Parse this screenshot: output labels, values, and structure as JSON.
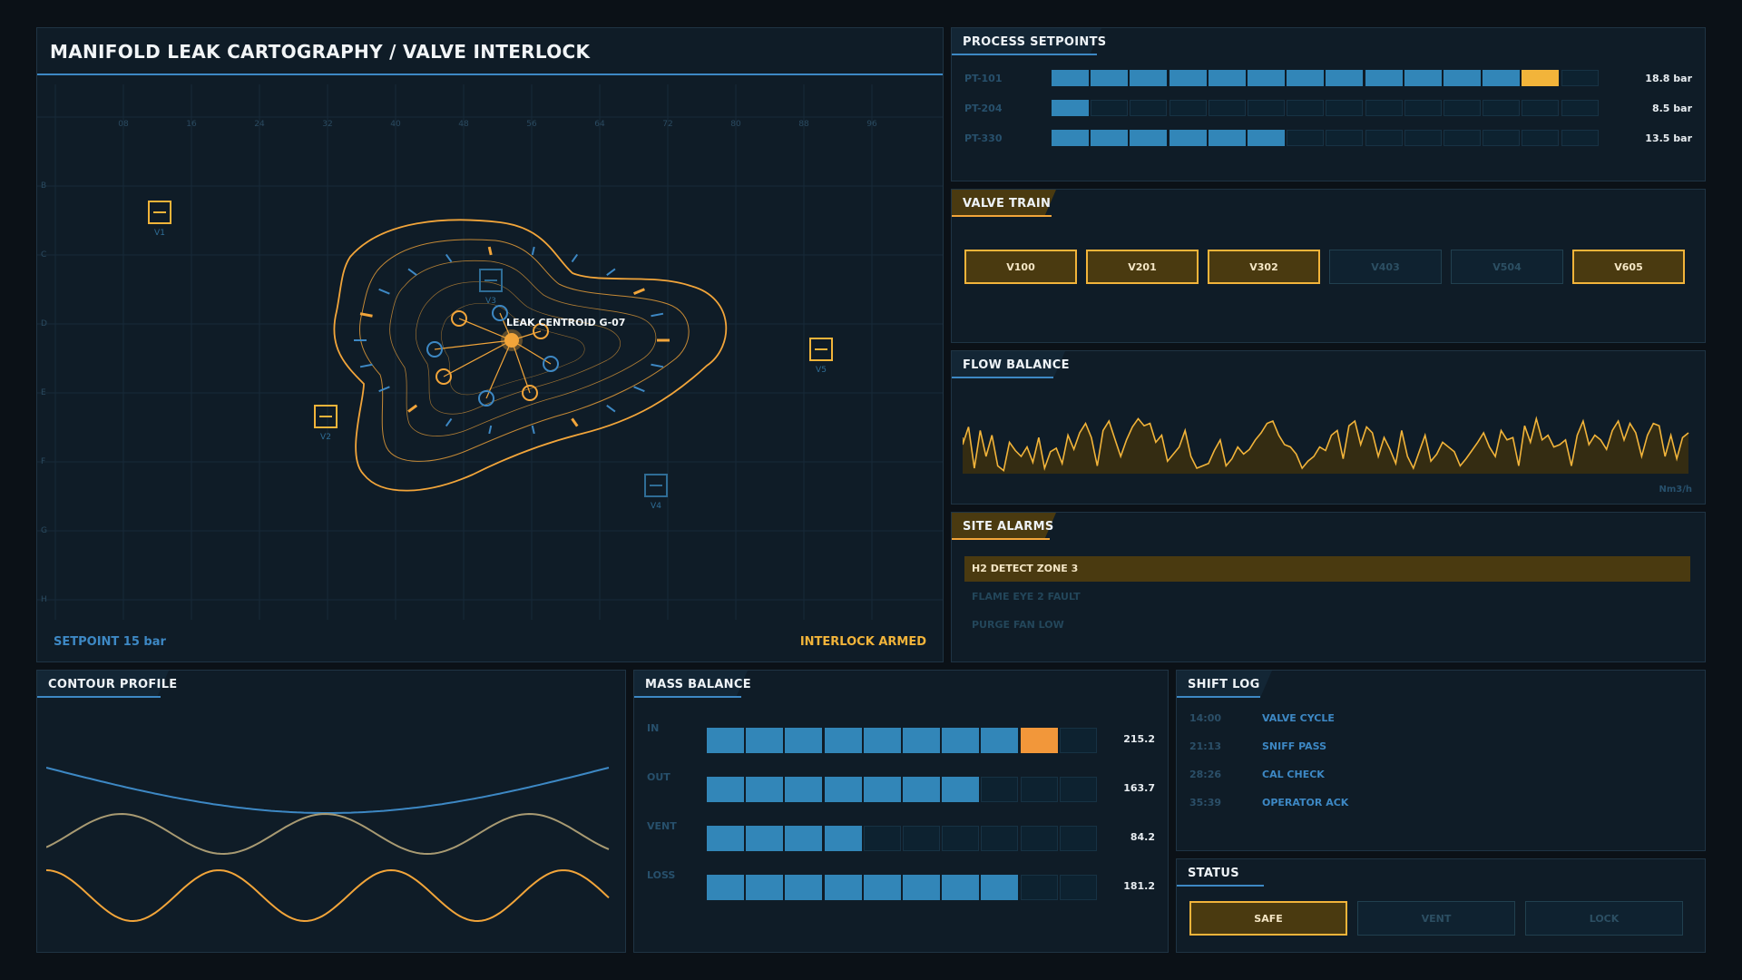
{
  "map": {
    "title": "MANIFOLD LEAK CARTOGRAPHY / VALVE INTERLOCK",
    "x_ticks": [
      "08",
      "16",
      "24",
      "32",
      "40",
      "48",
      "56",
      "64",
      "72",
      "80",
      "88",
      "96"
    ],
    "y_ticks": [
      "B",
      "C",
      "D",
      "E",
      "F",
      "G",
      "H"
    ],
    "valves": [
      "V1",
      "V2",
      "V3",
      "V4",
      "V5"
    ],
    "centroid_label": "LEAK CENTROID  G-07",
    "setpoint_text": "SETPOINT 15 bar",
    "interlock_text": "INTERLOCK ARMED"
  },
  "setpoints": {
    "title": "PROCESS SETPOINTS",
    "rows": [
      {
        "label": "PT-101",
        "value": "18.8 bar",
        "fill": 13,
        "accent": true
      },
      {
        "label": "PT-204",
        "value": "8.5 bar",
        "fill": 1,
        "accent": false
      },
      {
        "label": "PT-330",
        "value": "13.5 bar",
        "fill": 6,
        "accent": false
      }
    ],
    "segments": 14
  },
  "valve_train": {
    "title": "VALVE TRAIN",
    "valves": [
      {
        "label": "V100",
        "active": true
      },
      {
        "label": "V201",
        "active": true
      },
      {
        "label": "V302",
        "active": true
      },
      {
        "label": "V403",
        "active": false
      },
      {
        "label": "V504",
        "active": false
      },
      {
        "label": "V605",
        "active": true
      }
    ]
  },
  "flow": {
    "title": "FLOW BALANCE",
    "unit": "Nm3/h",
    "values": [
      40,
      55,
      20,
      52,
      30,
      48,
      22,
      18,
      42,
      35,
      30,
      38,
      25,
      46,
      20,
      34,
      37,
      24,
      48,
      36,
      50,
      58,
      46,
      22,
      52,
      60,
      45,
      30,
      44,
      55,
      62,
      56,
      58,
      42,
      48,
      26,
      32,
      38,
      52,
      30,
      20,
      22,
      24,
      35,
      44,
      22,
      28,
      38,
      32,
      36,
      44,
      50,
      58,
      60,
      48,
      40,
      38,
      32,
      20,
      26,
      30,
      38,
      35,
      48,
      52,
      28,
      56,
      60,
      40,
      55,
      50,
      30,
      46,
      36,
      24,
      52,
      30,
      20,
      34,
      48,
      26,
      32,
      42,
      38,
      34,
      22,
      28,
      35,
      42,
      50,
      38,
      30,
      52,
      44,
      46,
      22,
      56,
      42,
      62,
      44,
      48,
      38,
      40,
      44,
      22,
      48,
      60,
      40,
      48,
      44,
      36,
      52,
      60,
      44,
      58,
      50,
      30,
      48,
      58,
      56,
      30,
      48,
      28,
      46,
      50
    ]
  },
  "alarms": {
    "title": "SITE ALARMS",
    "items": [
      {
        "label": "H2 DETECT ZONE 3",
        "active": true
      },
      {
        "label": "FLAME EYE 2 FAULT",
        "active": false
      },
      {
        "label": "PURGE FAN LOW",
        "active": false
      }
    ]
  },
  "contour": {
    "title": "CONTOUR PROFILE"
  },
  "mass": {
    "title": "MASS BALANCE",
    "segments": 10,
    "rows": [
      {
        "label": "IN",
        "value": "215.2",
        "fill": 9,
        "accent": true
      },
      {
        "label": "OUT",
        "value": "163.7",
        "fill": 7,
        "accent": false
      },
      {
        "label": "VENT",
        "value": "84.2",
        "fill": 4,
        "accent": false
      },
      {
        "label": "LOSS",
        "value": "181.2",
        "fill": 8,
        "accent": false
      }
    ]
  },
  "shift_log": {
    "title": "SHIFT LOG",
    "entries": [
      {
        "time": "14:00",
        "event": "VALVE CYCLE"
      },
      {
        "time": "21:13",
        "event": "SNIFF PASS"
      },
      {
        "time": "28:26",
        "event": "CAL CHECK"
      },
      {
        "time": "35:39",
        "event": "OPERATOR ACK"
      }
    ]
  },
  "status": {
    "title": "STATUS",
    "buttons": [
      {
        "label": "SAFE",
        "active": true
      },
      {
        "label": "VENT",
        "active": false
      },
      {
        "label": "LOCK",
        "active": false
      }
    ]
  },
  "colors": {
    "accent": "#f2a53a",
    "blue": "#3d88c4",
    "bg": "#0b1117",
    "panel": "#0f1c27"
  }
}
